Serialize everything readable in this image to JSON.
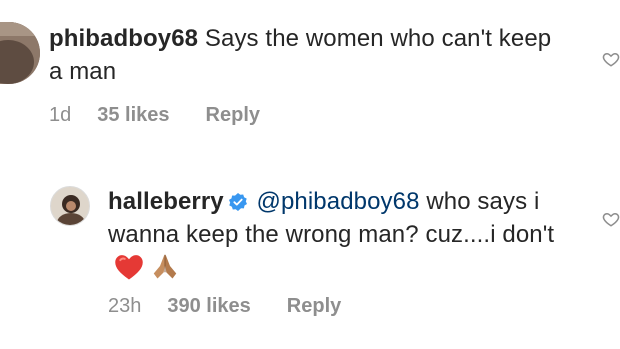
{
  "comments": [
    {
      "username": "phibadboy68",
      "text": "Says the women who can't keep a man",
      "time": "1d",
      "likes": "35 likes",
      "reply_label": "Reply",
      "verified": false
    },
    {
      "username": "halleberry",
      "mention": "@phibadboy68",
      "text": "who says i wanna keep the wrong man? cuz....i don't",
      "emojis": [
        "red-heart",
        "folded-hands"
      ],
      "time": "23h",
      "likes": "390 likes",
      "reply_label": "Reply",
      "verified": true
    }
  ],
  "colors": {
    "text": "#262626",
    "mention": "#00376b",
    "meta": "#8e8e8e",
    "verified_badge": "#3897f0"
  }
}
